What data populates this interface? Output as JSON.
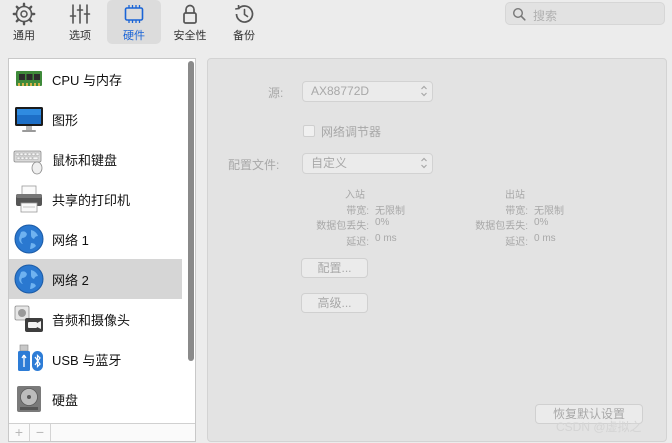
{
  "toolbar": {
    "items": [
      {
        "label": "通用",
        "icon": "gear-icon"
      },
      {
        "label": "选项",
        "icon": "sliders-icon"
      },
      {
        "label": "硬件",
        "icon": "hardware-icon"
      },
      {
        "label": "安全性",
        "icon": "lock-icon"
      },
      {
        "label": "备份",
        "icon": "clock-icon"
      }
    ],
    "active": "硬件",
    "search_placeholder": "搜索"
  },
  "sidebar": {
    "items": [
      {
        "label": "CPU 与内存",
        "icon": "memory-chip-icon"
      },
      {
        "label": "图形",
        "icon": "monitor-icon"
      },
      {
        "label": "鼠标和键盘",
        "icon": "keyboard-mouse-icon"
      },
      {
        "label": "共享的打印机",
        "icon": "printer-icon"
      },
      {
        "label": "网络 1",
        "icon": "network-globe-icon"
      },
      {
        "label": "网络 2",
        "icon": "network-globe-icon"
      },
      {
        "label": "音频和摄像头",
        "icon": "speaker-camera-icon"
      },
      {
        "label": "USB 与蓝牙",
        "icon": "usb-bluetooth-icon"
      },
      {
        "label": "硬盘",
        "icon": "hard-disk-icon"
      }
    ],
    "selected": "网络 2",
    "add_label": "+",
    "remove_label": "−"
  },
  "network": {
    "source_label": "源:",
    "source_value": "AX88772D",
    "conditioner_label": "网络调节器",
    "profile_label": "配置文件:",
    "profile_value": "自定义",
    "inbound": {
      "header": "入站",
      "bandwidth_label": "带宽:",
      "bandwidth_value": "无限制",
      "loss_label": "数据包丢失:",
      "loss_value": "0%",
      "delay_label": "延迟:",
      "delay_value": "0 ms"
    },
    "outbound": {
      "header": "出站",
      "bandwidth_label": "带宽:",
      "bandwidth_value": "无限制",
      "loss_label": "数据包丢失:",
      "loss_value": "0%",
      "delay_label": "延迟:",
      "delay_value": "0 ms"
    },
    "configure_button": "配置...",
    "advanced_button": "高级...",
    "restore_button": "恢复默认设置"
  },
  "watermark": "CSDN @虚拟之"
}
